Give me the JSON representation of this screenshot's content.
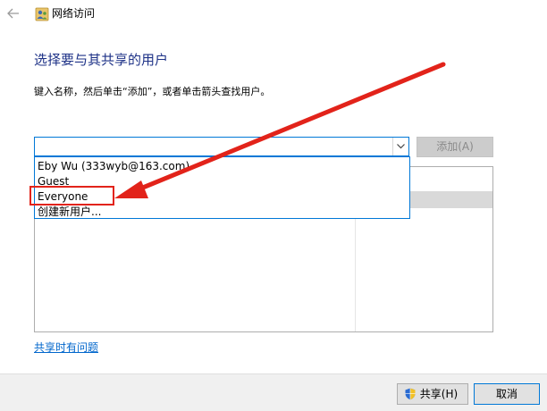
{
  "window": {
    "title": "网络访问",
    "back_icon": "back-arrow-icon",
    "app_icon": "network-users-icon"
  },
  "main": {
    "heading": "选择要与其共享的用户",
    "instruction": "键入名称，然后单击“添加”，或者单击箭头查找用户。",
    "combo": {
      "value": "",
      "placeholder": ""
    },
    "add_button": "添加(A)",
    "dropdown_items": [
      "Eby Wu (333wyb@163.com)",
      "Guest",
      "Everyone",
      "创建新用户..."
    ],
    "highlighted_item": "Everyone",
    "problem_link": "共享时有问题"
  },
  "footer": {
    "share_button": "共享(H)",
    "cancel_button": "取消"
  },
  "colors": {
    "heading": "#1e3287",
    "accent": "#0078d7",
    "annotation": "#e2231a",
    "link": "#0066cc"
  }
}
